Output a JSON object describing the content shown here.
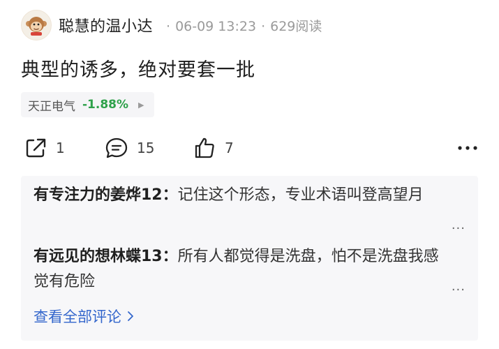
{
  "post": {
    "author": "聪慧的温小达",
    "time": "06-09 13:23",
    "views": "629阅读",
    "separator": "·",
    "text": "典型的诱多，绝对要套一批"
  },
  "stock": {
    "name": "天正电气",
    "change": "-1.88%",
    "change_color": "#2ea14a"
  },
  "actions": {
    "share_count": "1",
    "comment_count": "15",
    "like_count": "7"
  },
  "comments": [
    {
      "user": "有专注力的姜烨12：",
      "text": "记住这个形态，专业术语叫登高望月",
      "more": "..."
    },
    {
      "user": "有远见的想林蝶13：",
      "text": "所有人都觉得是洗盘，怕不是洗盘我感觉有危险",
      "more": "..."
    }
  ],
  "view_all_label": "查看全部评论",
  "icons": {
    "share": "share-icon",
    "comment": "comment-icon",
    "like": "thumbs-up-icon",
    "more": "more-icon",
    "chevron": "chevron-right-icon"
  }
}
